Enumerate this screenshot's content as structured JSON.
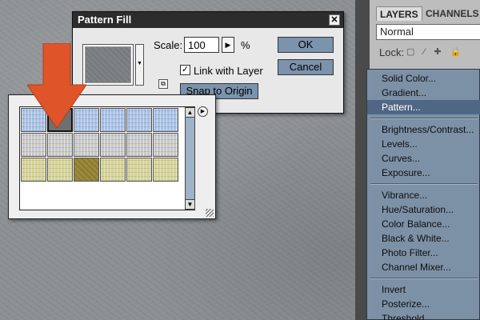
{
  "dialog": {
    "title": "Pattern Fill",
    "close_glyph": "✕",
    "scale_label": "Scale:",
    "scale_value": "100",
    "scale_unit": "%",
    "link_label": "Link with Layer",
    "link_checked": true,
    "check_glyph": "✓",
    "snap_label": "Snap to Origin",
    "ok_label": "OK",
    "cancel_label": "Cancel",
    "dropdown_glyph": "▼",
    "stepper_glyph": "▶",
    "new_preset_glyph": "⧉"
  },
  "picker": {
    "tiles": [
      [
        "blue",
        "selected",
        "blue",
        "blue",
        "blue",
        "blue"
      ],
      [
        "gray",
        "gray",
        "gray",
        "gray",
        "gray",
        "gray"
      ],
      [
        "yellow",
        "yellow",
        "brown",
        "yellow",
        "yellow",
        "yellow"
      ]
    ],
    "selected_tile": [
      0,
      1
    ],
    "scroll_up_glyph": "▲",
    "scroll_down_glyph": "▼",
    "menu_glyph": "▶"
  },
  "panel": {
    "tabs": [
      "LAYERS",
      "CHANNELS"
    ],
    "blend_mode": "Normal",
    "lock_label": "Lock:",
    "lock_icons": "▢ ⁄ ✚ 🔒"
  },
  "adjustment_menu": {
    "groups": [
      [
        "Solid Color...",
        "Gradient...",
        "Pattern..."
      ],
      [
        "Brightness/Contrast...",
        "Levels...",
        "Curves...",
        "Exposure..."
      ],
      [
        "Vibrance...",
        "Hue/Saturation...",
        "Color Balance...",
        "Black & White...",
        "Photo Filter...",
        "Channel Mixer..."
      ],
      [
        "Invert",
        "Posterize...",
        "Threshold..."
      ]
    ],
    "highlighted": "Pattern..."
  },
  "colors": {
    "menu_bg": "#7d91a6",
    "menu_hover": "#4f6784",
    "arrow": "#e0542a",
    "button_blue": "#7b93ad"
  },
  "icons": {
    "arrow": "down-arrow-annotation-icon"
  }
}
